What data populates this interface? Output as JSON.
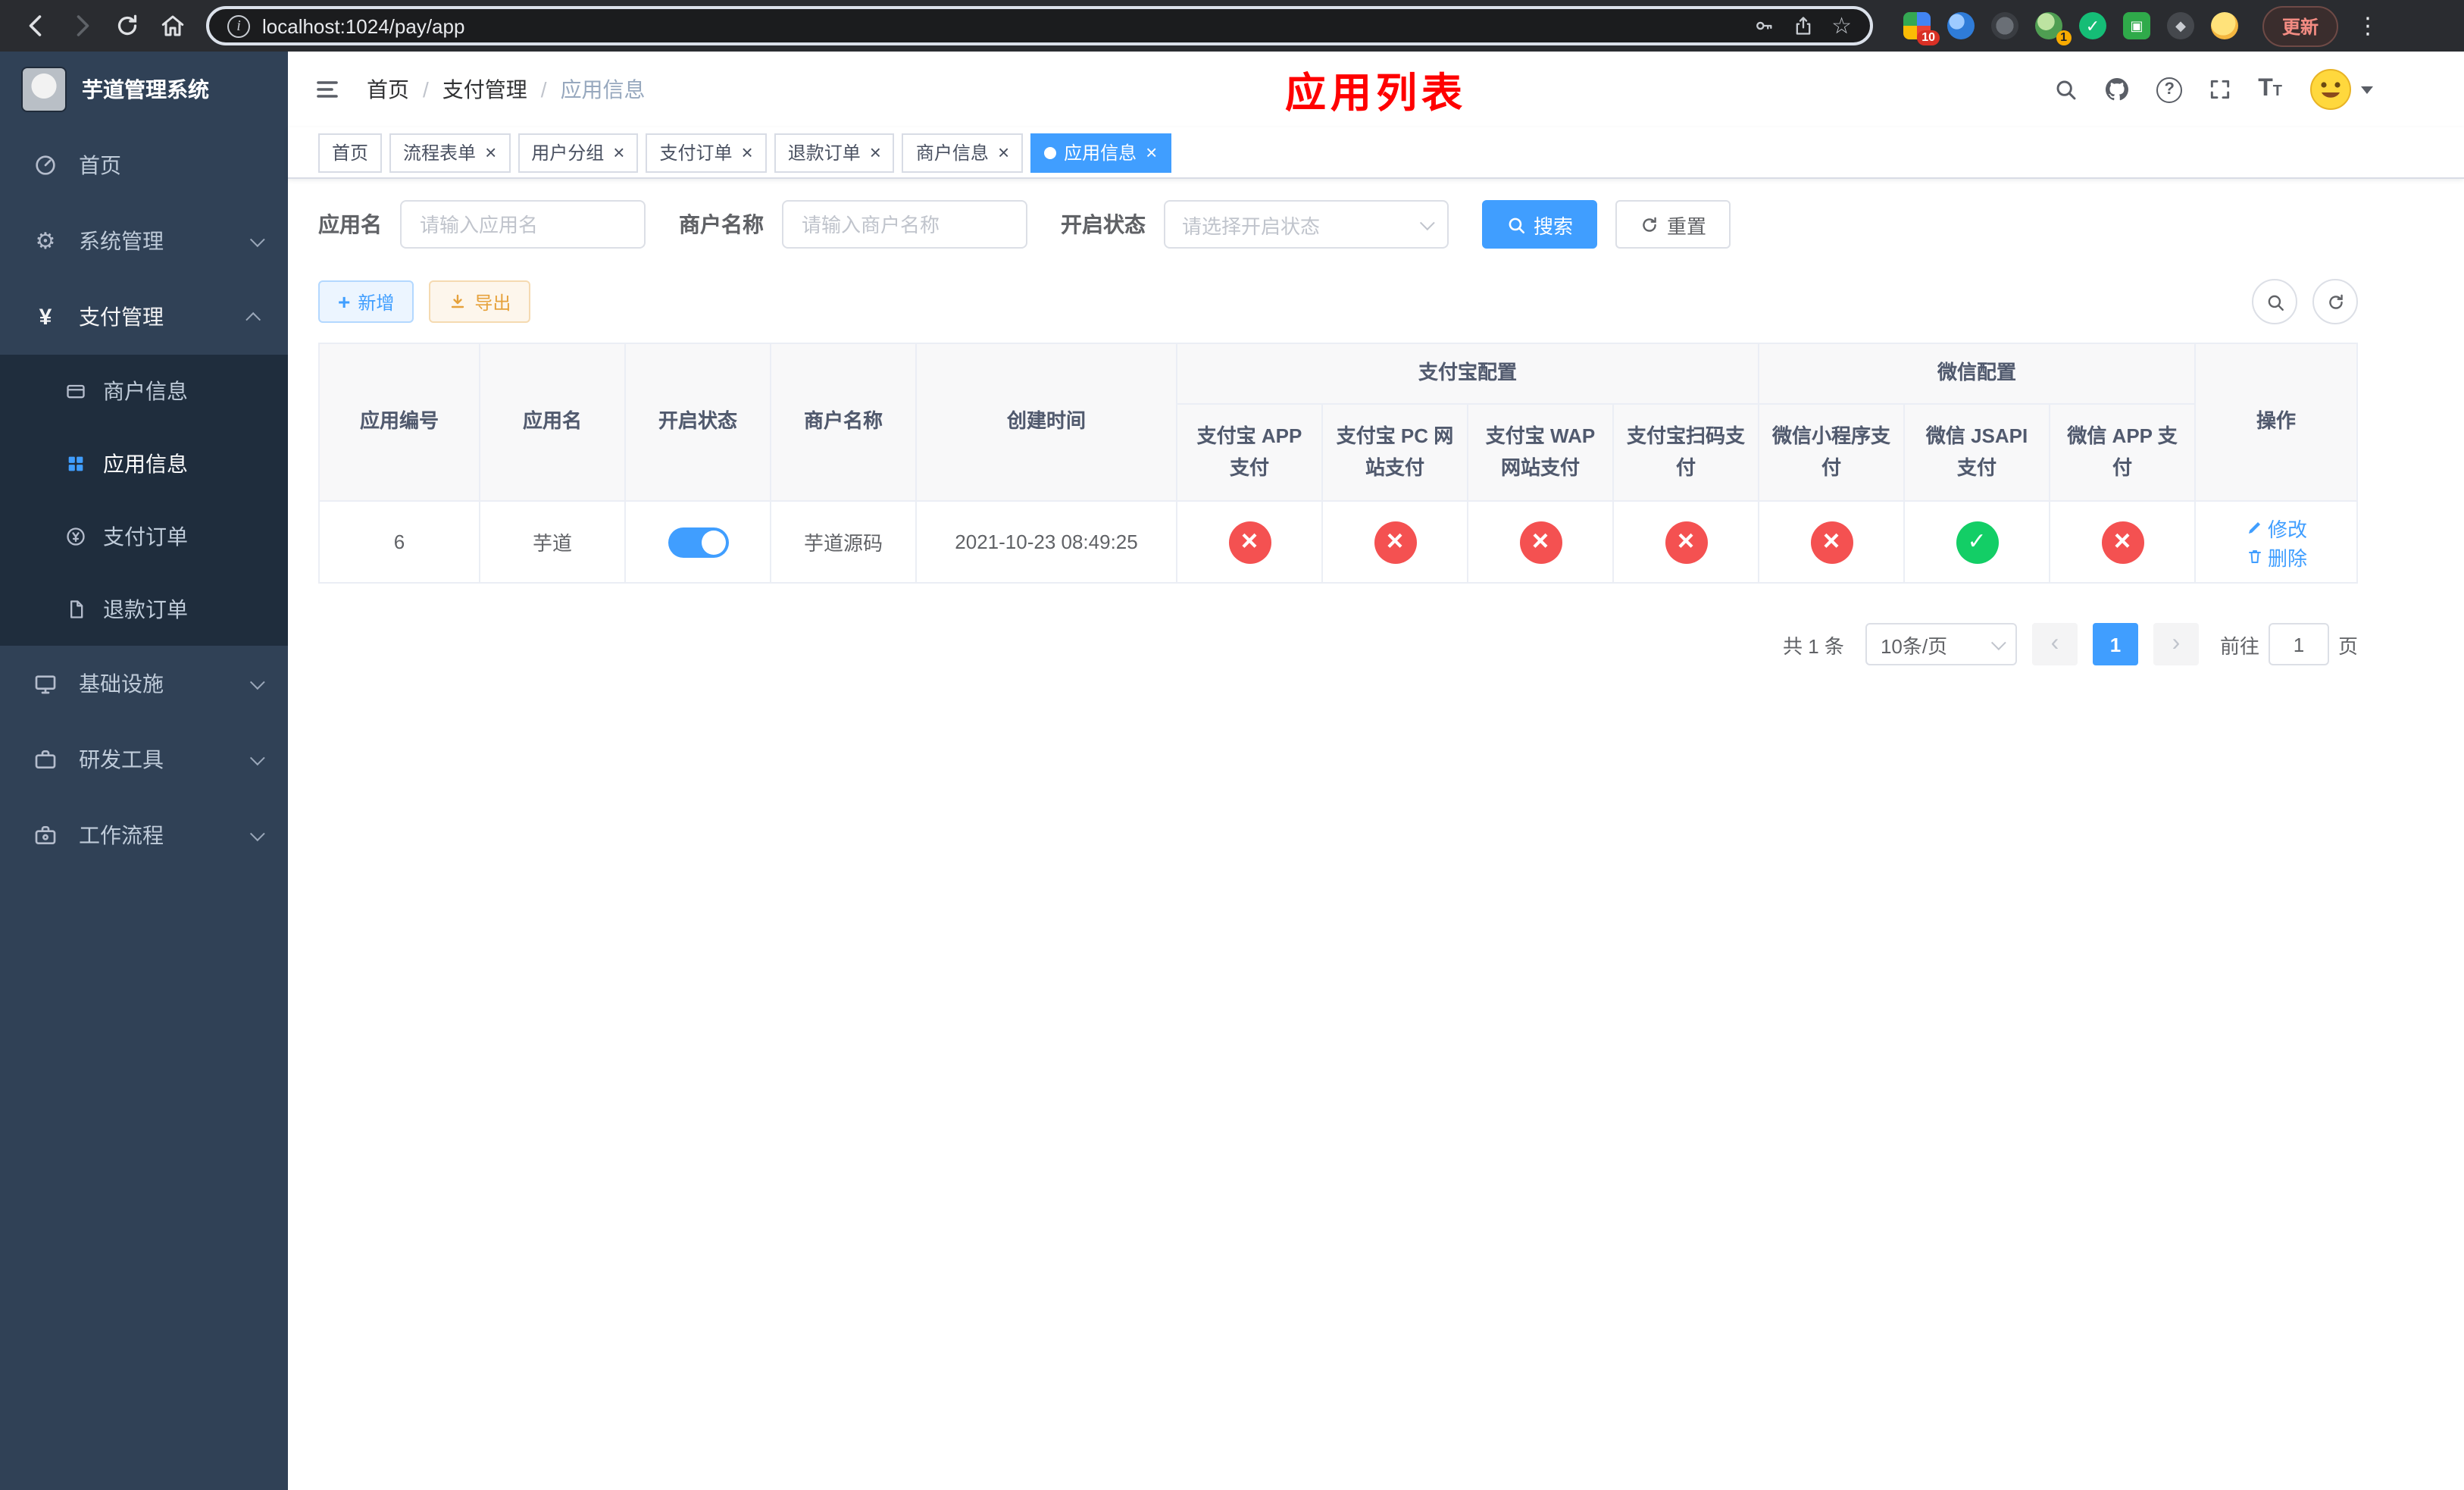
{
  "browser": {
    "url": "localhost:1024/pay/app",
    "update_label": "更新",
    "extension_badge_count": "10",
    "extension_badge_green": "1"
  },
  "sidebar": {
    "title": "芋道管理系统",
    "items": [
      {
        "label": "首页"
      },
      {
        "label": "系统管理"
      },
      {
        "label": "支付管理",
        "children": [
          {
            "label": "商户信息"
          },
          {
            "label": "应用信息"
          },
          {
            "label": "支付订单"
          },
          {
            "label": "退款订单"
          }
        ]
      },
      {
        "label": "基础设施"
      },
      {
        "label": "研发工具"
      },
      {
        "label": "工作流程"
      }
    ]
  },
  "navbar": {
    "breadcrumb": [
      "首页",
      "支付管理",
      "应用信息"
    ],
    "page_title": "应用列表"
  },
  "tags": [
    {
      "label": "首页"
    },
    {
      "label": "流程表单"
    },
    {
      "label": "用户分组"
    },
    {
      "label": "支付订单"
    },
    {
      "label": "退款订单"
    },
    {
      "label": "商户信息"
    },
    {
      "label": "应用信息"
    }
  ],
  "filters": {
    "app_name_label": "应用名",
    "app_name_placeholder": "请输入应用名",
    "merchant_label": "商户名称",
    "merchant_placeholder": "请输入商户名称",
    "status_label": "开启状态",
    "status_placeholder": "请选择开启状态",
    "search_label": "搜索",
    "reset_label": "重置"
  },
  "toolbar": {
    "add_label": "新增",
    "export_label": "导出"
  },
  "table": {
    "groups": {
      "alipay": "支付宝配置",
      "wechat": "微信配置"
    },
    "columns": {
      "id": "应用编号",
      "name": "应用名",
      "status": "开启状态",
      "merchant": "商户名称",
      "created": "创建时间",
      "alipay_app": "支付宝 APP 支付",
      "alipay_pc": "支付宝 PC 网站支付",
      "alipay_wap": "支付宝 WAP 网站支付",
      "alipay_qr": "支付宝扫码支付",
      "wx_lite": "微信小程序支付",
      "wx_jsapi": "微信 JSAPI 支付",
      "wx_app": "微信 APP 支付",
      "actions": "操作"
    },
    "row": {
      "id": "6",
      "name": "芋道",
      "enabled": true,
      "merchant": "芋道源码",
      "created": "2021-10-23 08:49:25",
      "alipay_app": false,
      "alipay_pc": false,
      "alipay_wap": false,
      "alipay_qr": false,
      "wx_lite": false,
      "wx_jsapi": true,
      "wx_app": false,
      "edit_label": "修改",
      "delete_label": "删除"
    }
  },
  "pagination": {
    "total_label": "共 1 条",
    "page_size_label": "10条/页",
    "current_page": "1",
    "goto_label": "前往",
    "goto_value": "1",
    "goto_unit": "页"
  },
  "colors": {
    "primary": "#409eff",
    "success": "#13ce66",
    "danger": "#f45151",
    "warning": "#e6a23c",
    "title_red": "#ff0000",
    "sidebar_bg": "#304156",
    "submenu_bg": "#1f2d3d"
  }
}
